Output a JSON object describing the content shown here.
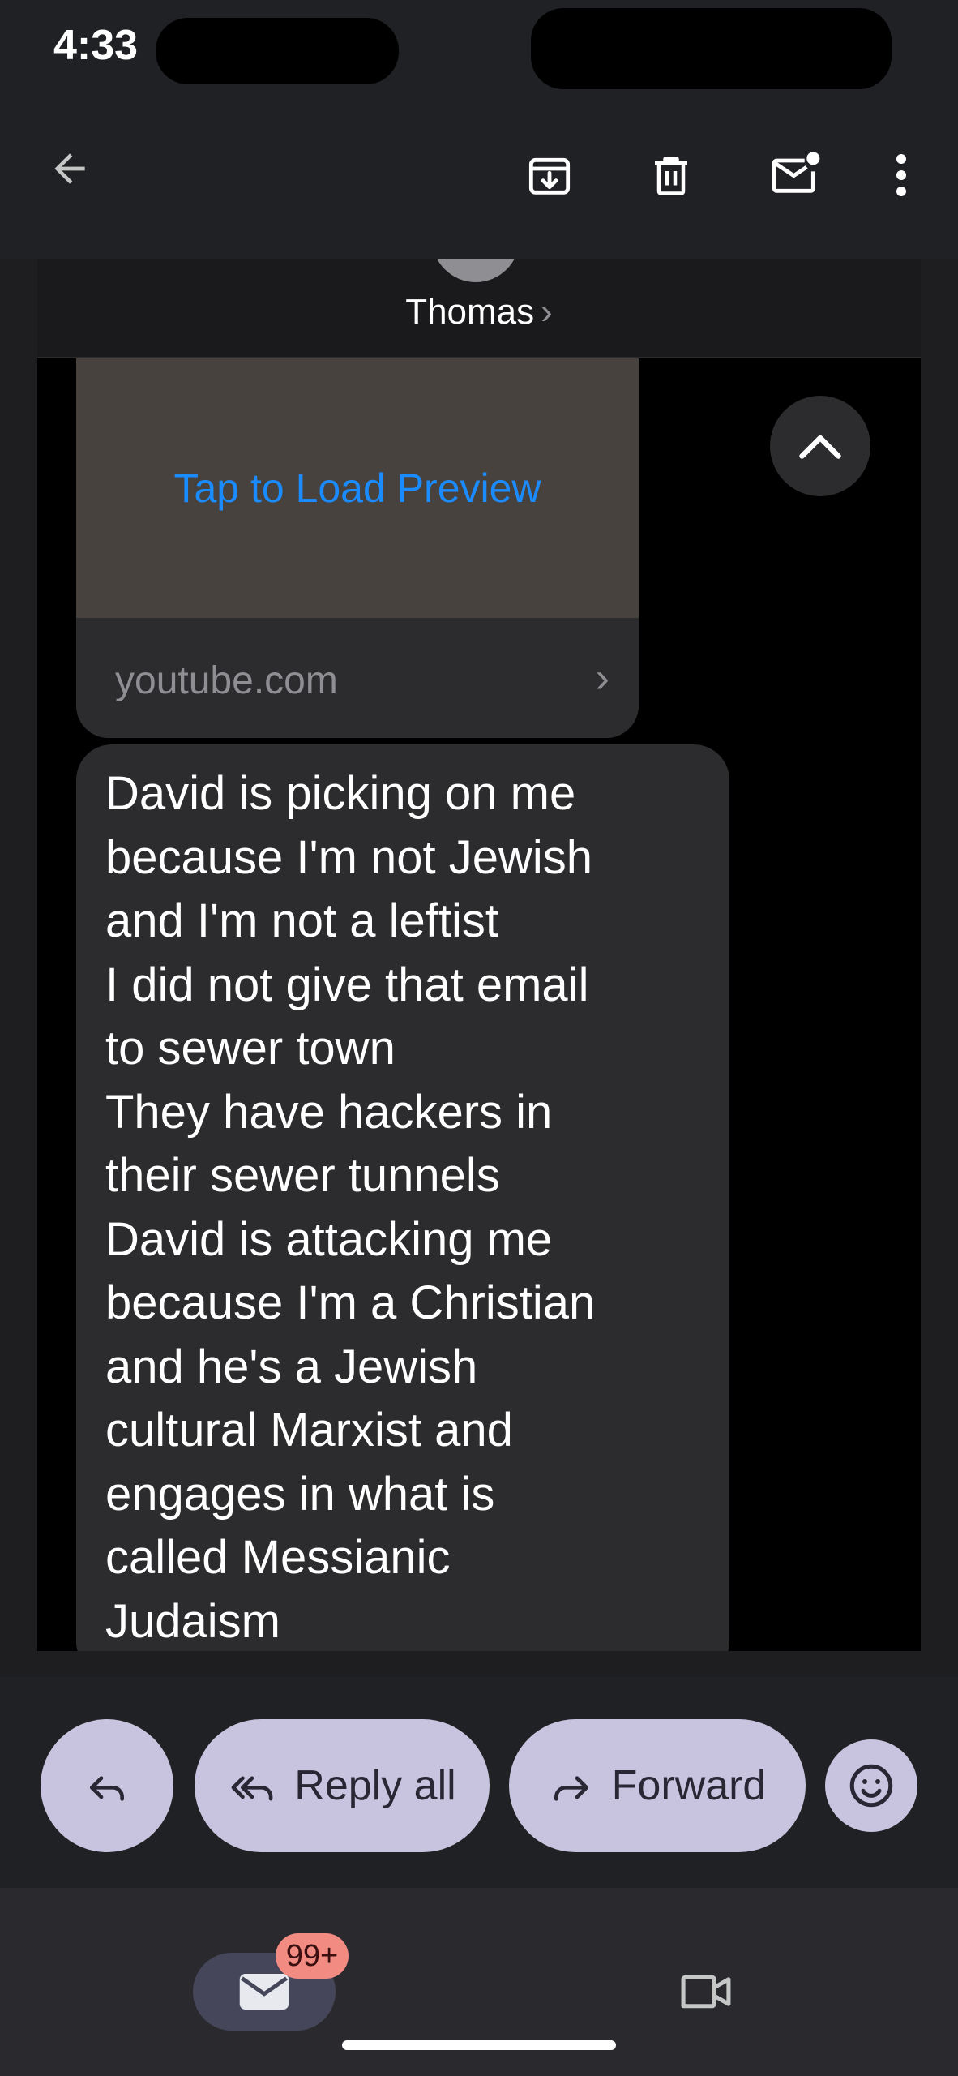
{
  "status_bar": {
    "time": "4:33"
  },
  "toolbar": {
    "back_icon": "arrow-back-icon",
    "archive_icon": "archive-icon",
    "delete_icon": "trash-icon",
    "mark_unread_icon": "mark-unread-icon",
    "more_icon": "more-vert-icon"
  },
  "attachment": {
    "sender_name": "Thomas",
    "sender_chevron": "›",
    "preview_action": "Tap to Load Preview",
    "preview_domain": "youtube.com",
    "preview_chevron": "›",
    "message_text": "David is picking on me\nbecause I'm not Jewish\nand I'm not a leftist\nI did not give that email\nto sewer town\nThey have hackers in\ntheir sewer tunnels\nDavid is attacking me\nbecause I'm a Christian\nand he's a Jewish\ncultural Marxist and\nengages in what is\ncalled Messianic\nJudaism"
  },
  "actions": {
    "reply_icon": "reply-icon",
    "reply_all_label": "Reply all",
    "forward_label": "Forward",
    "emoji_icon": "emoji-icon"
  },
  "bottom_nav": {
    "mail_badge": "99+",
    "mail_icon": "mail-icon",
    "video_icon": "video-icon"
  },
  "colors": {
    "background": "#202124",
    "pill": "#c8c3df",
    "link_blue": "#1a8cff",
    "badge": "#f28b82"
  }
}
